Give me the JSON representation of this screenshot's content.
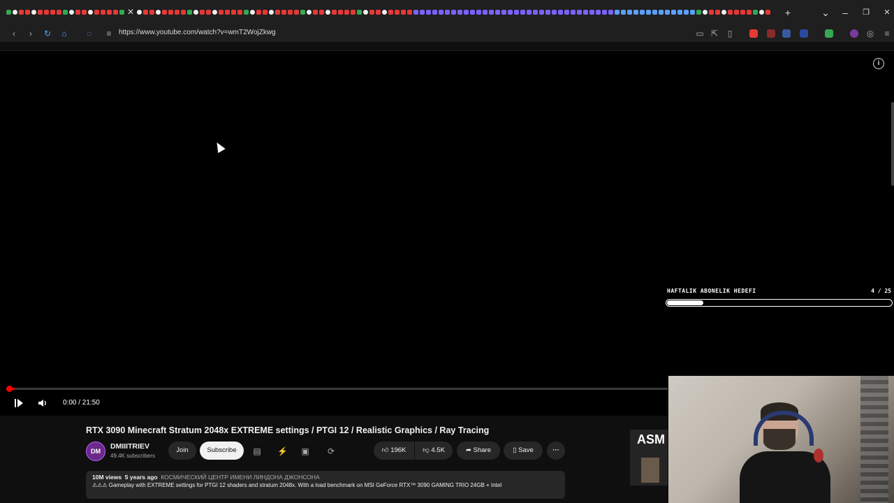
{
  "browser": {
    "url": "https://www.youtube.com/watch?v=wmT2WojZkwg",
    "new_tab": "+",
    "minimize": "–",
    "restore": "❐",
    "close": "✕"
  },
  "player": {
    "time": "0:00 / 21:50",
    "progress_fraction": 0.01
  },
  "overlay": {
    "goal_label": "HAFTALIK ABONELIK HEDEFI",
    "goal_count": "4 / 25",
    "goal_fraction": 0.16
  },
  "video_info": {
    "title": "RTX 3090 Minecraft Stratum 2048x EXTREME settings / PTGI 12 / Realistic Graphics / Ray Tracing",
    "channel_name": "DMIIITRIEV",
    "avatar_text": "DM",
    "subscribers": "49.4K subscribers",
    "join_label": "Join",
    "subscribe_label": "Subscribe",
    "likes": "196K",
    "dislikes": "4.5K",
    "share_label": "Share",
    "save_label": "Save",
    "views": "10M views",
    "age": "5 years ago",
    "location": "КОСМИЧЕСКИЙ ЦЕНТР ИМЕНИ ЛИНДОНА ДЖОНСОНА",
    "description": "⚠⚠⚠ Gameplay with EXTREME settings for PTGI 12 shaders and stratum 2048x. With a load benchmark on MSI GeForce RTX™ 3090 GAMING TRIO 24GB + Intel"
  },
  "sidebar_thumb": {
    "text": "ASM"
  },
  "colors": {
    "progress": "#ff0000",
    "background": "#0f0f0f"
  }
}
